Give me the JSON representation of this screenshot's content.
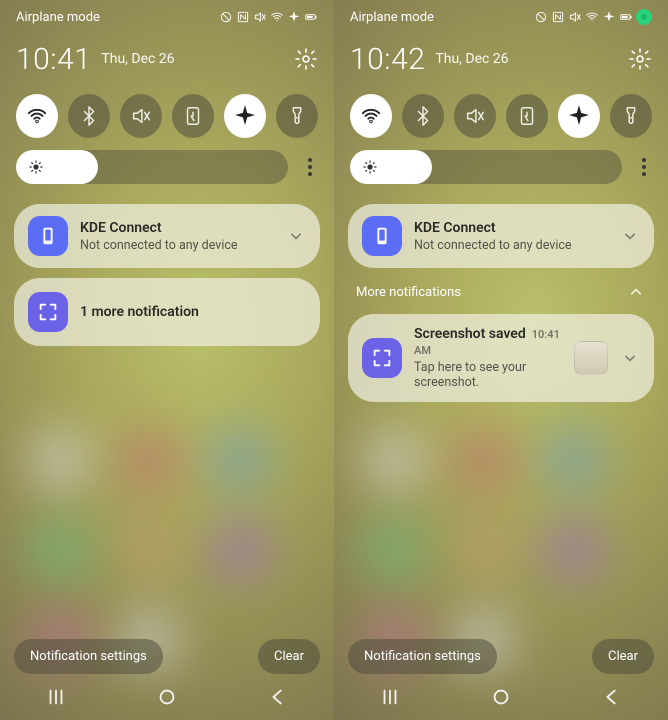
{
  "left": {
    "status_label": "Airplane mode",
    "clock": "10:41",
    "date": "Thu, Dec 26",
    "notif1": {
      "title": "KDE Connect",
      "sub": "Not connected to any device"
    },
    "summary": "1 more notification",
    "footer_settings": "Notification settings",
    "footer_clear": "Clear"
  },
  "right": {
    "status_label": "Airplane mode",
    "clock": "10:42",
    "date": "Thu, Dec 26",
    "notif1": {
      "title": "KDE Connect",
      "sub": "Not connected to any device"
    },
    "section": "More notifications",
    "notif2": {
      "title": "Screenshot saved",
      "time": "10:41 AM",
      "sub": "Tap here to see your screenshot."
    },
    "footer_settings": "Notification settings",
    "footer_clear": "Clear"
  },
  "qs_toggles": [
    {
      "name": "wifi",
      "on": true
    },
    {
      "name": "bluetooth",
      "on": false
    },
    {
      "name": "mute",
      "on": false
    },
    {
      "name": "battery-saver",
      "on": false
    },
    {
      "name": "airplane",
      "on": true
    },
    {
      "name": "flashlight",
      "on": false
    }
  ],
  "brightness_pct": 30,
  "camera_indicator_right": true
}
